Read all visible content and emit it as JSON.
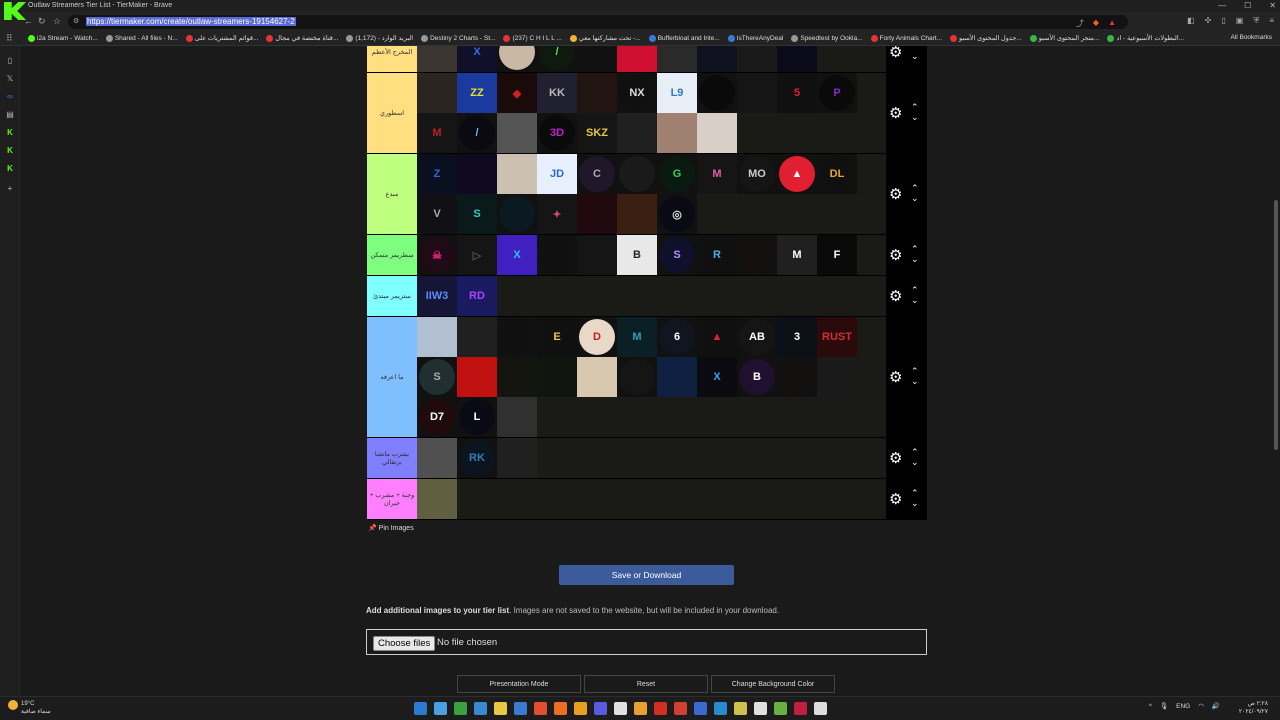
{
  "browser": {
    "window_title": "Outlaw Streamers Tier List - TierMaker - Brave",
    "url": "https://tiermaker.com/create/outlaw-streamers-19154627-2",
    "bookmarks": [
      {
        "label": "i2a Stream - Watch...",
        "color": "#53fc18"
      },
      {
        "label": "Shared - All files - N...",
        "color": "#999999"
      },
      {
        "label": "قوائم المشتريات على...",
        "color": "#e33333"
      },
      {
        "label": "قناة مختصة في مجال...",
        "color": "#e33333"
      },
      {
        "label": "البريد الوارد - (1,172)",
        "color": "#999999"
      },
      {
        "label": "Destiny 2 Charts - St...",
        "color": "#999999"
      },
      {
        "label": "(237) C H I L L ...",
        "color": "#e33333"
      },
      {
        "label": "تحت مشاركتها معي -...",
        "color": "#f3b23c"
      },
      {
        "label": "Bufferbloat and Inte...",
        "color": "#3b7bd6"
      },
      {
        "label": "IsThereAnyDeal",
        "color": "#3b7bd6"
      },
      {
        "label": "Speedtest by Ookla...",
        "color": "#999999"
      },
      {
        "label": "Forty Animals Chart...",
        "color": "#e33333"
      },
      {
        "label": "جدول المحتوى الأسبو...",
        "color": "#e33333"
      },
      {
        "label": "متجر المحتوى الأسبو...",
        "color": "#3bb54a"
      },
      {
        "label": "البطولات الأسبوعية - اد...",
        "color": "#3bb54a"
      }
    ],
    "all_bookmarks": "All Bookmarks"
  },
  "tiers": [
    {
      "label": "المخرج الأعظم",
      "color": "#ffdf7f",
      "items": [
        {
          "bg": "#3a3530",
          "fg": "#ccc",
          "text": ""
        },
        {
          "bg": "#10102a",
          "fg": "#3a6ae0",
          "text": "X"
        },
        {
          "bg": "#c9b8a3",
          "fg": "#8a2a1a",
          "text": "",
          "circle": true
        },
        {
          "bg": "#0f1a0f",
          "fg": "#5ddc6a",
          "text": "/",
          "circle": true
        },
        {
          "bg": "#111111",
          "fg": "#ddd",
          "text": "",
          "circle": true
        },
        {
          "bg": "#d01030",
          "fg": "#fff",
          "text": ""
        },
        {
          "bg": "#2a2a2a",
          "fg": "#bba",
          "text": ""
        },
        {
          "bg": "#0f1020",
          "fg": "#8a6ad0",
          "text": ""
        },
        {
          "bg": "#1a1a1a",
          "fg": "#aa8844",
          "text": ""
        },
        {
          "bg": "#0a0a1a",
          "fg": "#2a6ad0",
          "text": ""
        }
      ]
    },
    {
      "label": "اسطوري",
      "color": "#ffdf7f",
      "items": [
        {
          "bg": "#2a2520",
          "fg": "#ddd",
          "text": ""
        },
        {
          "bg": "#1a3aa0",
          "fg": "#e8e030",
          "text": "ZZ"
        },
        {
          "bg": "#1a0a0a",
          "fg": "#d02020",
          "text": "◆"
        },
        {
          "bg": "#202030",
          "fg": "#bbb",
          "text": "KK"
        },
        {
          "bg": "#201510",
          "fg": "#ddd",
          "text": ""
        },
        {
          "bg": "#101010",
          "fg": "#ddd",
          "text": "NX",
          "circle": true
        },
        {
          "bg": "#e8eef5",
          "fg": "#2a7ad0",
          "text": "L9"
        },
        {
          "bg": "#0a0a0a",
          "fg": "#d02020",
          "text": "",
          "circle": true
        },
        {
          "bg": "#151515",
          "fg": "#ddd",
          "text": ""
        },
        {
          "bg": "#101010",
          "fg": "#e02030",
          "text": "5"
        },
        {
          "bg": "#0a0a0a",
          "fg": "#8a2ad0",
          "text": "P",
          "circle": true
        },
        {
          "bg": "#151515",
          "fg": "#c02020",
          "text": "M"
        },
        {
          "bg": "#0a0a10",
          "fg": "#7ab0ff",
          "text": "/",
          "circle": true
        },
        {
          "bg": "#555555",
          "fg": "#ddd",
          "text": ""
        },
        {
          "bg": "#0a0a0a",
          "fg": "#c020d0",
          "text": "3D",
          "circle": true
        },
        {
          "bg": "#151515",
          "fg": "#e8c840",
          "text": "SKZ"
        },
        {
          "bg": "#202020",
          "fg": "#ddd",
          "text": ""
        },
        {
          "bg": "#a08070",
          "fg": "#222",
          "text": ""
        },
        {
          "bg": "#d8d0c8",
          "fg": "#333",
          "text": ""
        }
      ]
    },
    {
      "label": "مبدع",
      "color": "#bfff7f",
      "items": [
        {
          "bg": "#0a1020",
          "fg": "#2a6ad0",
          "text": "Z"
        },
        {
          "bg": "#100a20",
          "fg": "#b060ff",
          "text": ""
        },
        {
          "bg": "#ccc0b0",
          "fg": "#333",
          "text": ""
        },
        {
          "bg": "#e8f0ff",
          "fg": "#2a6ad0",
          "text": "JD"
        },
        {
          "bg": "#20182a",
          "fg": "#aaa",
          "text": "C",
          "circle": true
        },
        {
          "bg": "#1a1a1a",
          "fg": "#ddd",
          "text": "",
          "circle": true
        },
        {
          "bg": "#0a1a10",
          "fg": "#30d060",
          "text": "G",
          "circle": true
        },
        {
          "bg": "#151515",
          "fg": "#e060a0",
          "text": "M"
        },
        {
          "bg": "#151515",
          "fg": "#ccc",
          "text": "MO",
          "circle": true
        },
        {
          "bg": "#e02030",
          "fg": "#fff",
          "text": "▲",
          "circle": true
        },
        {
          "bg": "#101010",
          "fg": "#e8a820",
          "text": "DL",
          "circle": true
        },
        {
          "bg": "#101015",
          "fg": "#aaa",
          "text": "V"
        },
        {
          "bg": "#0a1a1a",
          "fg": "#30d0c0",
          "text": "S"
        },
        {
          "bg": "#0a1a20",
          "fg": "#3a8ad0",
          "text": "",
          "circle": true
        },
        {
          "bg": "#151515",
          "fg": "#d04080",
          "text": "✦"
        },
        {
          "bg": "#200a10",
          "fg": "#e07020",
          "text": ""
        },
        {
          "bg": "#3a2010",
          "fg": "#ddd",
          "text": ""
        },
        {
          "bg": "#0a0a15",
          "fg": "#ddd",
          "text": "◎",
          "circle": true
        }
      ]
    },
    {
      "label": "سطريمر متمكن",
      "color": "#7fff7f",
      "items": [
        {
          "bg": "#200a15",
          "fg": "#e02080",
          "text": "☠",
          "circle": true
        },
        {
          "bg": "#151515",
          "fg": "#555",
          "text": "▷"
        },
        {
          "bg": "#4020c0",
          "fg": "#30c0ff",
          "text": "X"
        },
        {
          "bg": "#101010",
          "fg": "#ccc",
          "text": "",
          "circle": true
        },
        {
          "bg": "#151515",
          "fg": "#ddd",
          "text": ""
        },
        {
          "bg": "#e8e8e8",
          "fg": "#222",
          "text": "B"
        },
        {
          "bg": "#10102a",
          "fg": "#b090ff",
          "text": "S",
          "circle": true
        },
        {
          "bg": "#101010",
          "fg": "#4ab0e0",
          "text": "R"
        },
        {
          "bg": "#151010",
          "fg": "#e06020",
          "text": "",
          "circle": true
        },
        {
          "bg": "#202020",
          "fg": "#fff",
          "text": "M"
        },
        {
          "bg": "#0a0a0a",
          "fg": "#fff",
          "text": "F"
        }
      ]
    },
    {
      "label": "ستريمر مبتدئ",
      "color": "#7fffff",
      "items": [
        {
          "bg": "#151535",
          "fg": "#5a8aff",
          "text": "IIW3"
        },
        {
          "bg": "#1a1a60",
          "fg": "#b040ff",
          "text": "RD"
        }
      ]
    },
    {
      "label": "ما اعرفه",
      "color": "#7fbfff",
      "items": [
        {
          "bg": "#b0c0d0",
          "fg": "#333",
          "text": ""
        },
        {
          "bg": "#202020",
          "fg": "#aaa",
          "text": ""
        },
        {
          "bg": "#101010",
          "fg": "#888",
          "text": "",
          "circle": true
        },
        {
          "bg": "#101010",
          "fg": "#e8c840",
          "text": "E"
        },
        {
          "bg": "#e8d8c8",
          "fg": "#c02020",
          "text": "D",
          "circle": true
        },
        {
          "bg": "#0a2025",
          "fg": "#30a0b0",
          "text": "M"
        },
        {
          "bg": "#101520",
          "fg": "#fff",
          "text": "6",
          "circle": true
        },
        {
          "bg": "#101010",
          "fg": "#e02040",
          "text": "▲"
        },
        {
          "bg": "#151515",
          "fg": "#fff",
          "text": "AB",
          "circle": true
        },
        {
          "bg": "#0a1015",
          "fg": "#fff",
          "text": "3"
        },
        {
          "bg": "#2a0a0a",
          "fg": "#d03030",
          "text": "RUST"
        },
        {
          "bg": "#203030",
          "fg": "#aaa",
          "text": "S",
          "circle": true
        },
        {
          "bg": "#c01010",
          "fg": "#000",
          "text": ""
        },
        {
          "bg": "#151510",
          "fg": "#aa9",
          "text": ""
        },
        {
          "bg": "#101510",
          "fg": "#b08030",
          "text": ""
        },
        {
          "bg": "#d8c8b0",
          "fg": "#333",
          "text": ""
        },
        {
          "bg": "#151515",
          "fg": "#ddd",
          "text": "",
          "circle": true
        },
        {
          "bg": "#102040",
          "fg": "#e02050",
          "text": ""
        },
        {
          "bg": "#0a0a10",
          "fg": "#3aa0ff",
          "text": "X"
        },
        {
          "bg": "#201030",
          "fg": "#fff",
          "text": "B",
          "circle": true
        },
        {
          "bg": "#151010",
          "fg": "#c02020",
          "text": "",
          "circle": true
        },
        {
          "bg": "#1a1a1a",
          "fg": "#ddd",
          "text": ""
        },
        {
          "bg": "#200a0a",
          "fg": "#fff",
          "text": "D7",
          "circle": true
        },
        {
          "bg": "#0a0a15",
          "fg": "#fff",
          "text": "L",
          "circle": true
        },
        {
          "bg": "#303030",
          "fg": "#ddd",
          "text": ""
        }
      ]
    },
    {
      "label": "يشرب ماتشا برتقالي",
      "color": "#7f7fff",
      "items": [
        {
          "bg": "#505050",
          "fg": "#ddd",
          "text": ""
        },
        {
          "bg": "#0a1520",
          "fg": "#3a7ab0",
          "text": "RK",
          "circle": true
        },
        {
          "bg": "#202020",
          "fg": "#999",
          "text": ""
        }
      ]
    },
    {
      "label": "وجبة + مشرب + جيران",
      "color": "#ff7fff",
      "items": [
        {
          "bg": "#606040",
          "fg": "#ddd",
          "text": ""
        }
      ]
    }
  ],
  "pin_images": "Pin Images",
  "save_button": "Save or Download",
  "additional_bold": "Add additional images to your tier list",
  "additional_rest": ". Images are not saved to the website, but will be included in your download.",
  "choose_files": "Choose files",
  "no_file": "No file chosen",
  "buttons": {
    "presentation": "Presentation Mode",
    "reset": "Reset",
    "change_bg": "Change Background Color"
  },
  "taskbar": {
    "temperature": "19°C",
    "weather_desc": "سماء صافية",
    "lang": "ENG",
    "time": "٢:٢٨ ص",
    "date": "٢٠٢٤/٠٩/٢٧"
  }
}
